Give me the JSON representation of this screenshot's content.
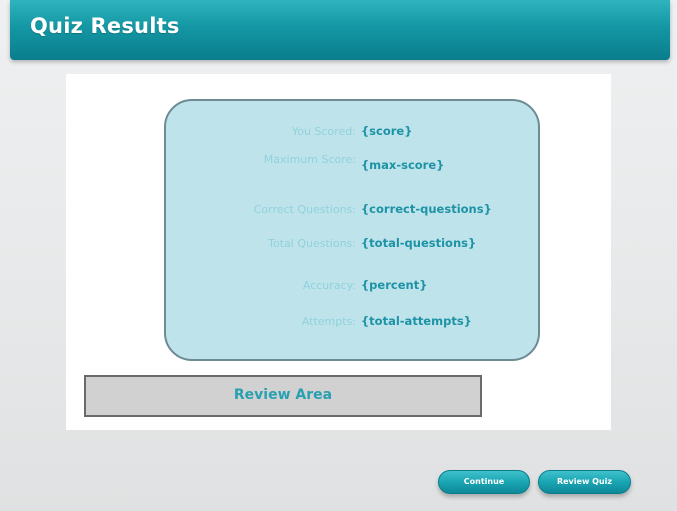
{
  "header": {
    "title": "Quiz Results"
  },
  "results": {
    "rows": [
      {
        "label": "You Scored:",
        "value": "{score}"
      },
      {
        "label": "Maximum Score:",
        "value": "{max-score}"
      },
      {
        "label": "Correct Questions:",
        "value": "{correct-questions}"
      },
      {
        "label": "Total Questions:",
        "value": "{total-questions}"
      },
      {
        "label": "Accuracy:",
        "value": "{percent}"
      },
      {
        "label": "Attempts:",
        "value": "{total-attempts}"
      }
    ]
  },
  "review": {
    "label": "Review Area"
  },
  "buttons": {
    "continue_label": "Continue",
    "review_quiz_label": "Review Quiz"
  },
  "colors": {
    "accent": "#1497a4",
    "score_box_fill": "#bfe3ea",
    "value_text": "#1d93a6",
    "label_text": "#8fd2dd",
    "review_fill": "#d1d1d1"
  }
}
